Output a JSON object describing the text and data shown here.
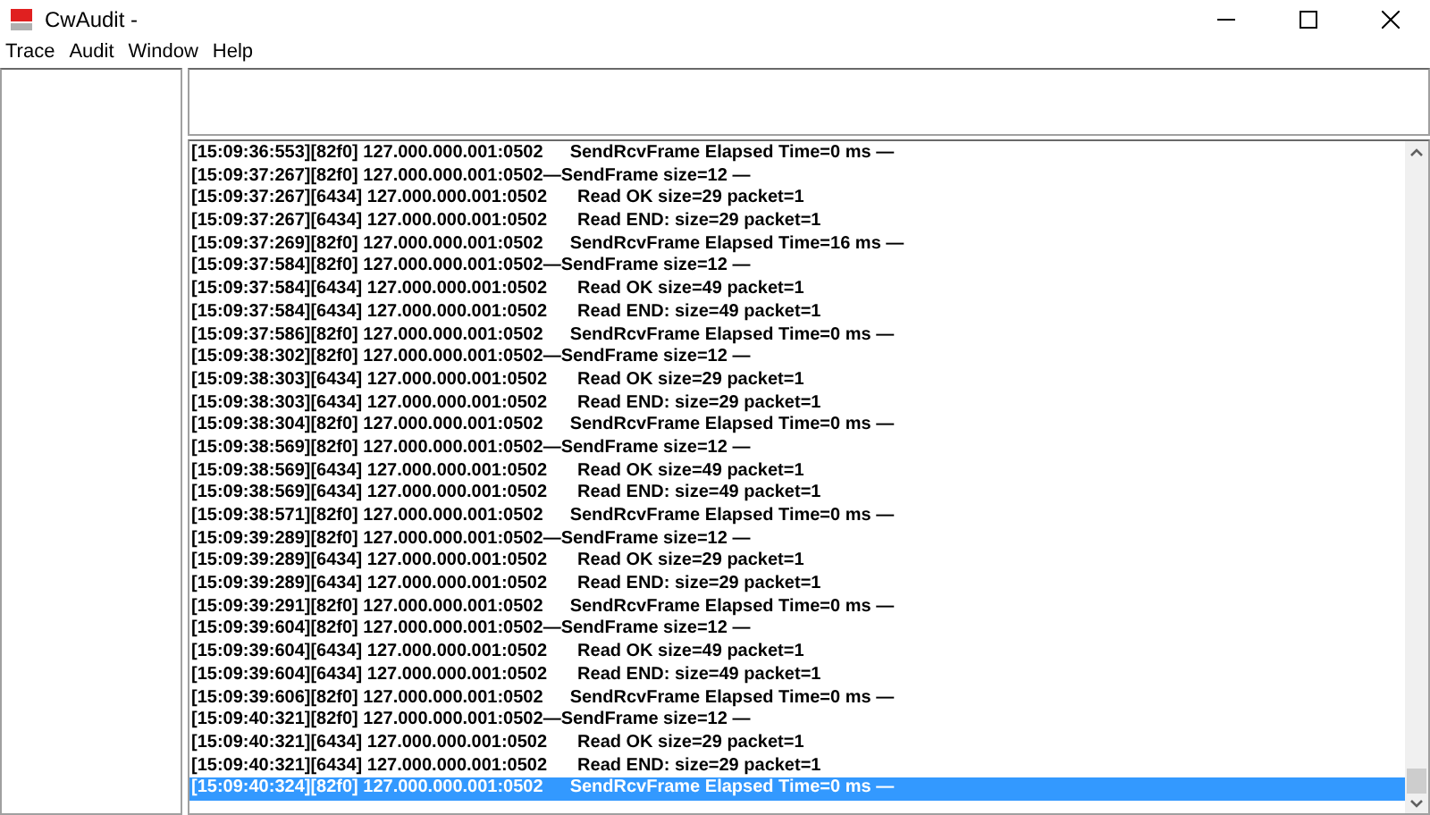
{
  "window": {
    "title": "CwAudit -"
  },
  "menu": [
    "Trace",
    "Audit",
    "Window",
    "Help"
  ],
  "log": [
    {
      "source": "[15:09:36:553][82f0] 127.000.000.001:0502",
      "kind": "elapsed",
      "message": "SendRcvFrame Elapsed Time=0 ms —",
      "selected": false
    },
    {
      "source": "[15:09:37:267][82f0] 127.000.000.001:0502",
      "kind": "send",
      "message": "—SendFrame size=12 —",
      "selected": false
    },
    {
      "source": "[15:09:37:267][6434] 127.000.000.001:0502",
      "kind": "read",
      "message": "Read OK size=29 packet=1",
      "selected": false
    },
    {
      "source": "[15:09:37:267][6434] 127.000.000.001:0502",
      "kind": "read",
      "message": "Read END: size=29 packet=1",
      "selected": false
    },
    {
      "source": "[15:09:37:269][82f0] 127.000.000.001:0502",
      "kind": "elapsed",
      "message": "SendRcvFrame Elapsed Time=16 ms —",
      "selected": false
    },
    {
      "source": "[15:09:37:584][82f0] 127.000.000.001:0502",
      "kind": "send",
      "message": "—SendFrame size=12 —",
      "selected": false
    },
    {
      "source": "[15:09:37:584][6434] 127.000.000.001:0502",
      "kind": "read",
      "message": "Read OK size=49 packet=1",
      "selected": false
    },
    {
      "source": "[15:09:37:584][6434] 127.000.000.001:0502",
      "kind": "read",
      "message": "Read END: size=49 packet=1",
      "selected": false
    },
    {
      "source": "[15:09:37:586][82f0] 127.000.000.001:0502",
      "kind": "elapsed",
      "message": "SendRcvFrame Elapsed Time=0 ms —",
      "selected": false
    },
    {
      "source": "[15:09:38:302][82f0] 127.000.000.001:0502",
      "kind": "send",
      "message": "—SendFrame size=12 —",
      "selected": false
    },
    {
      "source": "[15:09:38:303][6434] 127.000.000.001:0502",
      "kind": "read",
      "message": "Read OK size=29 packet=1",
      "selected": false
    },
    {
      "source": "[15:09:38:303][6434] 127.000.000.001:0502",
      "kind": "read",
      "message": "Read END: size=29 packet=1",
      "selected": false
    },
    {
      "source": "[15:09:38:304][82f0] 127.000.000.001:0502",
      "kind": "elapsed",
      "message": "SendRcvFrame Elapsed Time=0 ms —",
      "selected": false
    },
    {
      "source": "[15:09:38:569][82f0] 127.000.000.001:0502",
      "kind": "send",
      "message": "—SendFrame size=12 —",
      "selected": false
    },
    {
      "source": "[15:09:38:569][6434] 127.000.000.001:0502",
      "kind": "read",
      "message": "Read OK size=49 packet=1",
      "selected": false
    },
    {
      "source": "[15:09:38:569][6434] 127.000.000.001:0502",
      "kind": "read",
      "message": "Read END: size=49 packet=1",
      "selected": false
    },
    {
      "source": "[15:09:38:571][82f0] 127.000.000.001:0502",
      "kind": "elapsed",
      "message": "SendRcvFrame Elapsed Time=0 ms —",
      "selected": false
    },
    {
      "source": "[15:09:39:289][82f0] 127.000.000.001:0502",
      "kind": "send",
      "message": "—SendFrame size=12 —",
      "selected": false
    },
    {
      "source": "[15:09:39:289][6434] 127.000.000.001:0502",
      "kind": "read",
      "message": "Read OK size=29 packet=1",
      "selected": false
    },
    {
      "source": "[15:09:39:289][6434] 127.000.000.001:0502",
      "kind": "read",
      "message": "Read END: size=29 packet=1",
      "selected": false
    },
    {
      "source": "[15:09:39:291][82f0] 127.000.000.001:0502",
      "kind": "elapsed",
      "message": "SendRcvFrame Elapsed Time=0 ms —",
      "selected": false
    },
    {
      "source": "[15:09:39:604][82f0] 127.000.000.001:0502",
      "kind": "send",
      "message": "—SendFrame size=12 —",
      "selected": false
    },
    {
      "source": "[15:09:39:604][6434] 127.000.000.001:0502",
      "kind": "read",
      "message": "Read OK size=49 packet=1",
      "selected": false
    },
    {
      "source": "[15:09:39:604][6434] 127.000.000.001:0502",
      "kind": "read",
      "message": "Read END: size=49 packet=1",
      "selected": false
    },
    {
      "source": "[15:09:39:606][82f0] 127.000.000.001:0502",
      "kind": "elapsed",
      "message": "SendRcvFrame Elapsed Time=0 ms —",
      "selected": false
    },
    {
      "source": "[15:09:40:321][82f0] 127.000.000.001:0502",
      "kind": "send",
      "message": "—SendFrame size=12 —",
      "selected": false
    },
    {
      "source": "[15:09:40:321][6434] 127.000.000.001:0502",
      "kind": "read",
      "message": "Read OK size=29 packet=1",
      "selected": false
    },
    {
      "source": "[15:09:40:321][6434] 127.000.000.001:0502",
      "kind": "read",
      "message": "Read END: size=29 packet=1",
      "selected": false
    },
    {
      "source": "[15:09:40:324][82f0] 127.000.000.001:0502",
      "kind": "elapsed",
      "message": "SendRcvFrame Elapsed Time=0 ms —",
      "selected": true
    }
  ]
}
